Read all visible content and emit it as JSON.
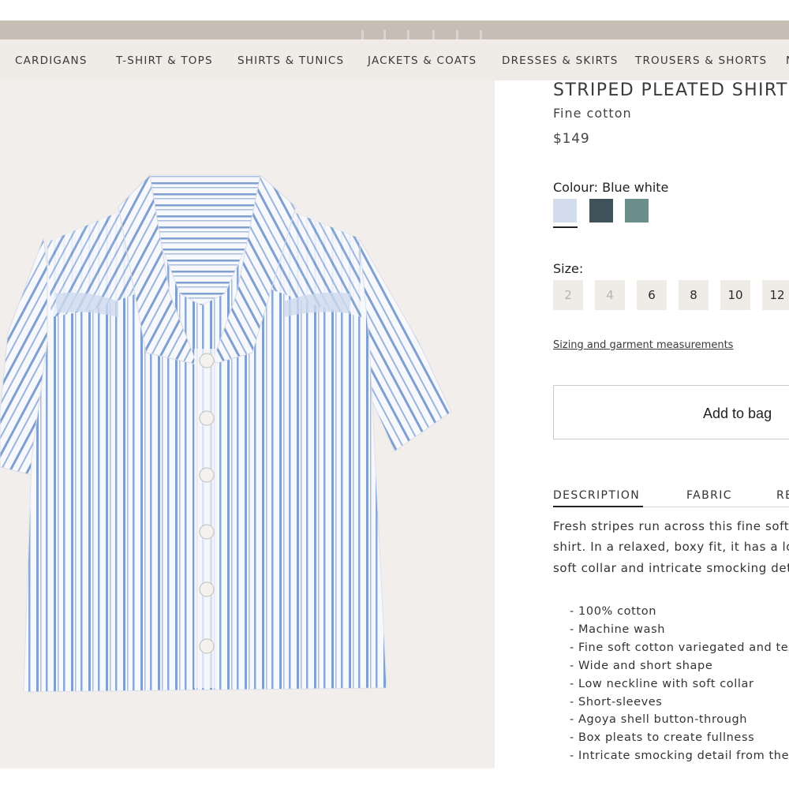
{
  "nav": {
    "items": [
      "CARDIGANS",
      "T-SHIRT & TOPS",
      "SHIRTS & TUNICS",
      "JACKETS & COATS",
      "DRESSES & SKIRTS",
      "TROUSERS & SHORTS",
      "N"
    ]
  },
  "product": {
    "title": "STRIPED PLEATED SHIRT",
    "subtitle": "Fine cotton",
    "price": "$149",
    "colour_label": "Colour: Blue white",
    "swatches": [
      {
        "name": "Blue white",
        "color": "#d3dcec",
        "selected": true
      },
      {
        "name": "dark slate",
        "color": "#3f5159",
        "selected": false
      },
      {
        "name": "teal",
        "color": "#6b8f8c",
        "selected": false
      }
    ],
    "size_label": "Size:",
    "sizes": [
      {
        "label": "2",
        "available": false
      },
      {
        "label": "4",
        "available": false
      },
      {
        "label": "6",
        "available": true
      },
      {
        "label": "8",
        "available": true
      },
      {
        "label": "10",
        "available": true
      },
      {
        "label": "12",
        "available": true
      }
    ],
    "sizing_link": "Sizing and garment measurements",
    "add_to_bag": "Add to bag"
  },
  "tabs": [
    {
      "label": "DESCRIPTION",
      "active": true
    },
    {
      "label": "FABRIC",
      "active": false
    },
    {
      "label": "RE",
      "active": false
    }
  ],
  "description": {
    "lines": [
      "Fresh stripes run across this fine soft",
      "shirt. In a relaxed, boxy fit, it has a lo",
      "soft collar and intricate smocking det"
    ],
    "bullets": [
      "- 100% cotton",
      "- Machine wash",
      "- Fine soft cotton variegated and tex",
      "- Wide and short shape",
      "- Low neckline with soft collar",
      "- Short-sleeves",
      "- Agoya shell button-through",
      "- Box pleats to create fullness",
      "- Intricate smocking detail from the y"
    ]
  },
  "colors": {
    "nav_bg": "#efebe7",
    "brand_bar": "#c6bdb4",
    "image_bg": "#f1eeeb",
    "stripe_blue": "#7f9fd0"
  }
}
